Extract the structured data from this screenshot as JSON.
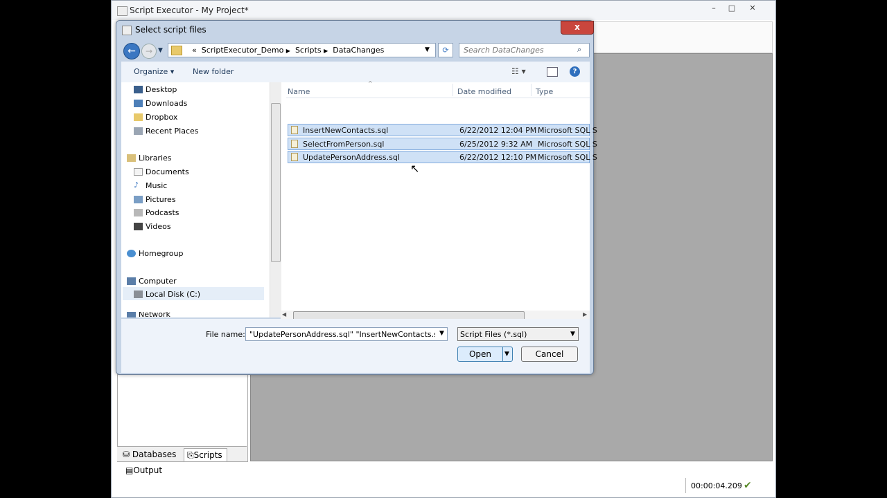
{
  "app": {
    "title": "Script Executor - My Project*",
    "tabs": [
      "Databases",
      "Scripts"
    ],
    "output_label": "Output",
    "status_time": "00:00:04.209"
  },
  "dialog": {
    "title": "Select script files",
    "close_glyph": "x",
    "breadcrumbs": [
      "«",
      "ScriptExecutor_Demo",
      "Scripts",
      "DataChanges"
    ],
    "search_placeholder": "Search DataChanges",
    "toolbar": {
      "organize": "Organize ▾",
      "new_folder": "New folder"
    },
    "nav_items": [
      {
        "label": "Desktop",
        "icon": "desktop-icon"
      },
      {
        "label": "Downloads",
        "icon": "downloads-icon"
      },
      {
        "label": "Dropbox",
        "icon": "dropbox-icon"
      },
      {
        "label": "Recent Places",
        "icon": "recent-places-icon"
      },
      {
        "label": "Libraries",
        "icon": "libraries-icon"
      },
      {
        "label": "Documents",
        "icon": "documents-icon"
      },
      {
        "label": "Music",
        "icon": "music-icon"
      },
      {
        "label": "Pictures",
        "icon": "pictures-icon"
      },
      {
        "label": "Podcasts",
        "icon": "podcasts-icon"
      },
      {
        "label": "Videos",
        "icon": "videos-icon"
      },
      {
        "label": "Homegroup",
        "icon": "homegroup-icon"
      },
      {
        "label": "Computer",
        "icon": "computer-icon"
      },
      {
        "label": "Local Disk (C:)",
        "icon": "local-disk-icon"
      },
      {
        "label": "Network",
        "icon": "network-icon"
      }
    ],
    "columns": [
      "Name",
      "Date modified",
      "Type"
    ],
    "files": [
      {
        "name": "InsertNewContacts.sql",
        "date": "6/22/2012 12:04 PM",
        "type": "Microsoft SQL S"
      },
      {
        "name": "SelectFromPerson.sql",
        "date": "6/25/2012 9:32 AM",
        "type": "Microsoft SQL S"
      },
      {
        "name": "UpdatePersonAddress.sql",
        "date": "6/22/2012 12:10 PM",
        "type": "Microsoft SQL S"
      }
    ],
    "file_name_label": "File name:",
    "file_name_value": "\"UpdatePersonAddress.sql\" \"InsertNewContacts.sql\" \"Sé",
    "file_type_filter": "Script Files (*.sql)",
    "open_label": "Open",
    "cancel_label": "Cancel"
  },
  "colors": {
    "selection": "#cfe1f6",
    "accent": "#3b77c2",
    "close": "#c9463d"
  }
}
